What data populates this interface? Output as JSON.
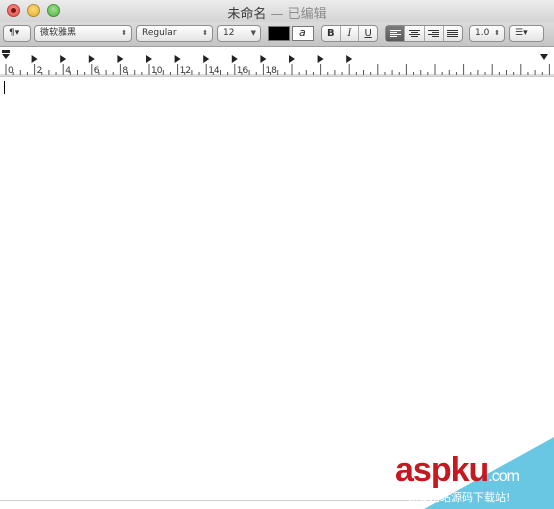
{
  "window": {
    "title": "未命名",
    "separator": " — ",
    "status": "已编辑"
  },
  "toolbar": {
    "paragraph_style": "¶▾",
    "font_family": "微软雅黑",
    "font_typeface": "Regular",
    "font_size": "12",
    "bold": "B",
    "italic": "I",
    "underline": "U",
    "line_spacing": "1.0",
    "list_style": "☰▾",
    "text_color": "#000000",
    "highlight_color": "#ffffff"
  },
  "ruler": {
    "labels": [
      "0",
      "2",
      "4",
      "6",
      "8",
      "10",
      "12",
      "14",
      "16",
      "18"
    ]
  },
  "document": {
    "content": ""
  },
  "watermark": {
    "brand": "aspku",
    "suffix": ".com",
    "tagline": "免费网站源码下载站!"
  }
}
